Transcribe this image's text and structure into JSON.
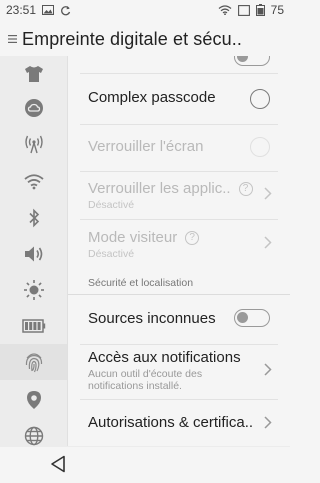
{
  "status": {
    "time": "23:51",
    "battery_level": "75",
    "icons": [
      "image-icon",
      "sync-icon",
      "wifi-icon",
      "sim-icon",
      "battery-icon"
    ]
  },
  "header": {
    "title": "Empreinte digitale et sécu.."
  },
  "sidebar": {
    "items": [
      {
        "icon": "theme-shirt-icon",
        "active": false
      },
      {
        "icon": "cloud-account-icon",
        "active": false
      },
      {
        "icon": "hotspot-antenna-icon",
        "active": false
      },
      {
        "icon": "wifi-icon",
        "active": false
      },
      {
        "icon": "bluetooth-icon",
        "active": false
      },
      {
        "icon": "sound-speaker-icon",
        "active": false
      },
      {
        "icon": "brightness-sun-icon",
        "active": false
      },
      {
        "icon": "battery-icon",
        "active": false
      },
      {
        "icon": "fingerprint-icon",
        "active": true
      },
      {
        "icon": "location-pin-icon",
        "active": false
      },
      {
        "icon": "globe-language-icon",
        "active": false
      }
    ]
  },
  "main": {
    "rows": [
      {
        "label": "Complex passcode",
        "control": "radio",
        "enabled": true
      },
      {
        "label": "Verrouiller l'écran",
        "control": "radio",
        "enabled": false
      },
      {
        "label": "Verrouiller les applic..",
        "sub": "Désactivé",
        "control": "chevron",
        "help": true,
        "enabled": false
      },
      {
        "label": "Mode visiteur",
        "sub": "Désactivé",
        "control": "chevron",
        "help": true,
        "enabled": false
      }
    ],
    "section_header": "Sécurité et localisation",
    "rows2": [
      {
        "label": "Sources inconnues",
        "control": "toggle",
        "checked": false,
        "enabled": true
      },
      {
        "label": "Accès aux notifications",
        "sub": "Aucun outil d'écoute des notifications installé.",
        "control": "chevron",
        "enabled": true
      },
      {
        "label": "Autorisations & certifica..",
        "control": "chevron",
        "enabled": true
      }
    ],
    "help_glyph": "?"
  },
  "colors": {
    "background": "#f5f5f5",
    "sidebar": "#ececec",
    "text_primary": "#222222",
    "text_disabled": "#b9b9b9"
  }
}
